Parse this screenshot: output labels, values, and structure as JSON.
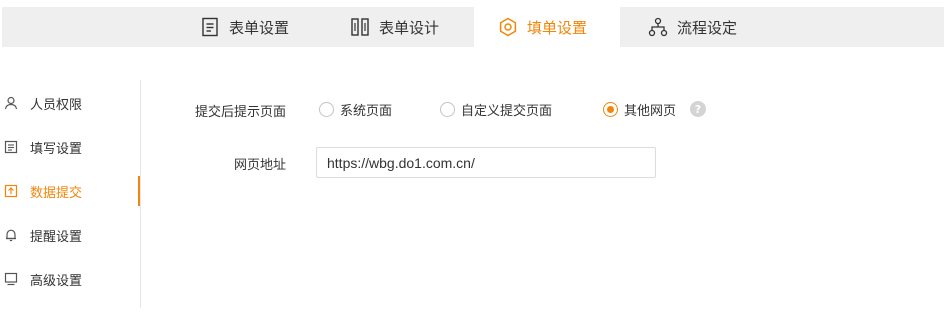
{
  "colors": {
    "accent": "#f0870a",
    "tabbar_bg": "#efefef",
    "text": "#333333"
  },
  "tabs": [
    {
      "label": "表单设置",
      "icon": "document-list-icon",
      "active": false
    },
    {
      "label": "表单设计",
      "icon": "columns-icon",
      "active": false
    },
    {
      "label": "填单设置",
      "icon": "gear-icon",
      "active": true
    },
    {
      "label": "流程设定",
      "icon": "flow-chart-icon",
      "active": false
    }
  ],
  "sidebar": {
    "items": [
      {
        "label": "人员权限",
        "icon": "user-icon",
        "active": false
      },
      {
        "label": "填写设置",
        "icon": "form-icon",
        "active": false
      },
      {
        "label": "数据提交",
        "icon": "upload-icon",
        "active": true
      },
      {
        "label": "提醒设置",
        "icon": "bell-icon",
        "active": false
      },
      {
        "label": "高级设置",
        "icon": "monitor-icon",
        "active": false
      }
    ]
  },
  "form": {
    "submit_page_label": "提交后提示页面",
    "options": [
      {
        "label": "系统页面",
        "checked": false
      },
      {
        "label": "自定义提交页面",
        "checked": false
      },
      {
        "label": "其他网页",
        "checked": true
      }
    ],
    "help_glyph": "?",
    "url_label": "网页地址",
    "url_value": "https://wbg.do1.com.cn/"
  }
}
